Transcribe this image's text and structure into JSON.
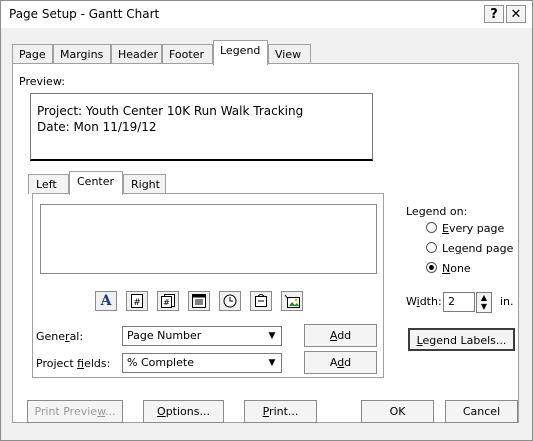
{
  "window": {
    "title": "Page Setup - Gantt Chart",
    "help_label": "?",
    "close_label": "✕"
  },
  "tabs": [
    "Page",
    "Margins",
    "Header",
    "Footer",
    "Legend",
    "View"
  ],
  "active_tab": "Legend",
  "preview": {
    "label": "Preview:",
    "line1": "Project: Youth Center 10K Run Walk Tracking",
    "line2": "Date: Mon 11/19/12"
  },
  "subtabs": [
    "Left",
    "Center",
    "Right"
  ],
  "active_subtab": "Center",
  "insert_icons": [
    "font-icon",
    "page-number-icon",
    "total-pages-icon",
    "date-icon",
    "time-icon",
    "file-name-icon",
    "picture-icon"
  ],
  "general": {
    "label": "General:",
    "value": "Page Number",
    "add": "Add"
  },
  "project_fields": {
    "label": "Project fields:",
    "value": "% Complete",
    "add": "Add"
  },
  "legend_on": {
    "label": "Legend on:",
    "options": [
      "Every page",
      "Legend page",
      "None"
    ],
    "selected": "None"
  },
  "width": {
    "label": "Width:",
    "value": "2",
    "unit": "in."
  },
  "legend_labels_button": "Legend Labels...",
  "footer": {
    "print_preview": "Print Preview...",
    "options": "Options...",
    "print": "Print...",
    "ok": "OK",
    "cancel": "Cancel"
  }
}
